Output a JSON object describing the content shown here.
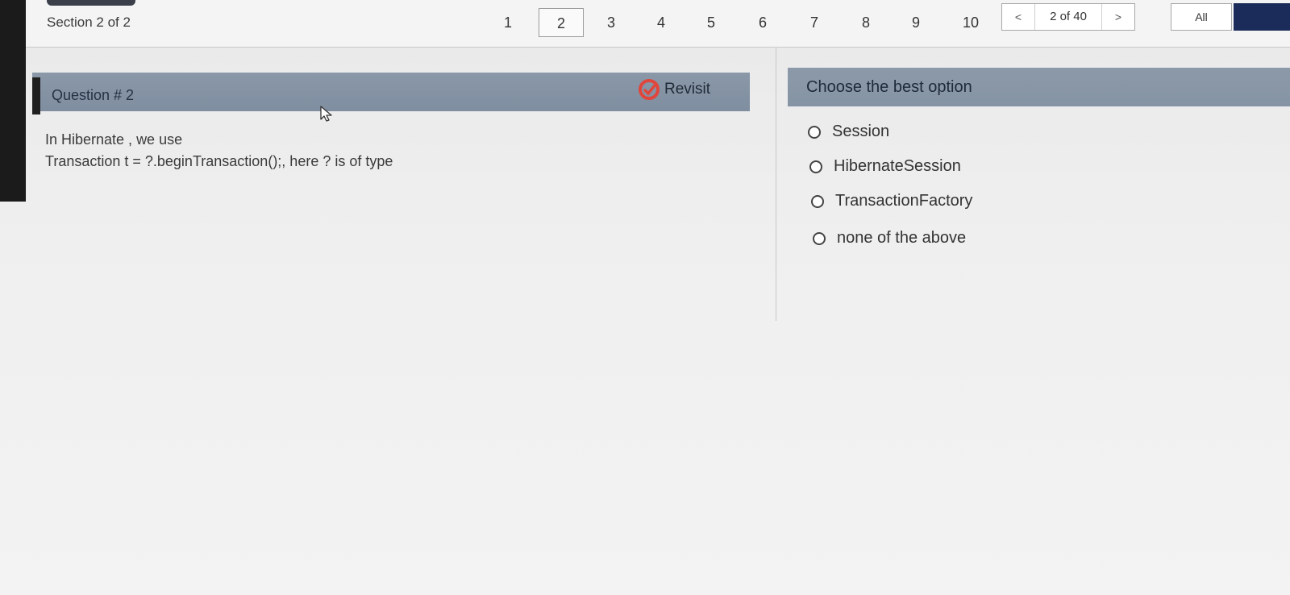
{
  "header": {
    "section_label": "Section 2 of 2",
    "question_numbers": [
      "1",
      "2",
      "3",
      "4",
      "5",
      "6",
      "7",
      "8",
      "9",
      "10"
    ],
    "current_number": "2",
    "pager": {
      "prev": "<",
      "label": "2 of 40",
      "next": ">"
    },
    "all_label": "All"
  },
  "question": {
    "title": "Question # 2",
    "revisit_label": "Revisit",
    "text_line1": "In Hibernate , we use",
    "text_line2": "Transaction t = ?.beginTransaction();, here ? is of type"
  },
  "options": {
    "title": "Choose the best option",
    "items": [
      "Session",
      "HibernateSession",
      "TransactionFactory",
      "none of the above"
    ]
  },
  "colors": {
    "header_bar": "#8a98a8",
    "revisit_icon": "#e0463c",
    "accent_bar": "#1f1f1f"
  }
}
